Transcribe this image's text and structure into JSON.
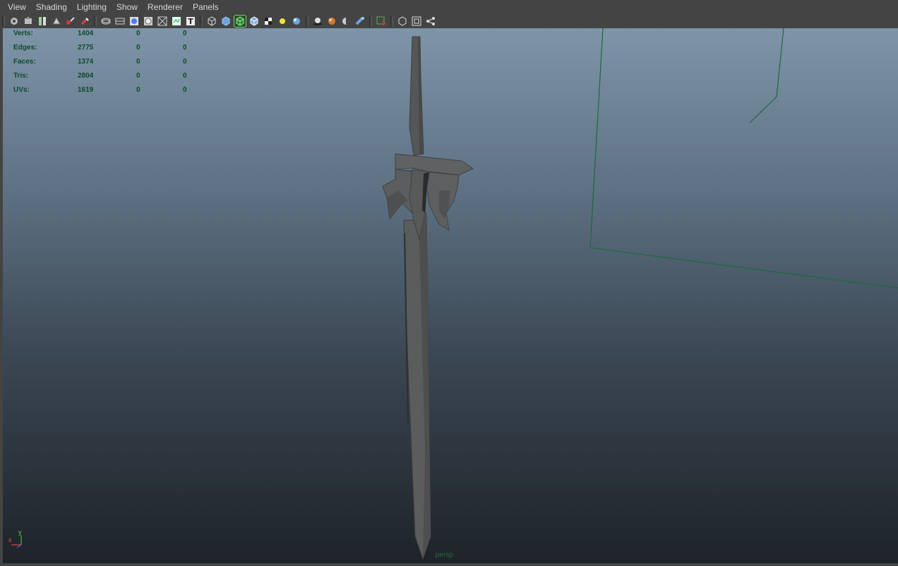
{
  "menu": [
    "View",
    "Shading",
    "Lighting",
    "Show",
    "Renderer",
    "Panels"
  ],
  "toolbar": {
    "groups": [
      [
        "camera-attributes-icon",
        "camera-bookmark-icon",
        "image-plane-icon",
        "2d-pan-zoom-icon",
        "grease-pencil-icon",
        "film-gate-icon"
      ],
      [
        "grid-icon",
        "resolution-gate-icon",
        "field-chart-icon",
        "safe-action-icon",
        "safe-title-icon",
        "heads-up-display-icon",
        "text-icon"
      ],
      [
        "wireframe-icon",
        "smooth-shade-icon",
        "wireframe-on-shaded-icon",
        "bounding-box-icon",
        "textured-icon",
        "default-light-icon",
        "use-all-lights-icon"
      ],
      [
        "shadows-icon",
        "ambient-occlusion-icon",
        "screen-space-ao-icon",
        "motion-blur-icon"
      ],
      [
        "xray-selection-icon"
      ],
      [
        "isolate-select-icon",
        "xray-icon",
        "node-editor-icon"
      ]
    ],
    "text_glyph": "T"
  },
  "hud": {
    "rows": [
      {
        "label": "Verts:",
        "v1": "1404",
        "v2": "0",
        "v3": "0"
      },
      {
        "label": "Edges:",
        "v1": "2775",
        "v2": "0",
        "v3": "0"
      },
      {
        "label": "Faces:",
        "v1": "1374",
        "v2": "0",
        "v3": "0"
      },
      {
        "label": "Tris:",
        "v1": "2804",
        "v2": "0",
        "v3": "0"
      },
      {
        "label": "UVs:",
        "v1": "1619",
        "v2": "0",
        "v3": "0"
      }
    ]
  },
  "viewport": {
    "camera": "persp",
    "axis": {
      "x": "x",
      "y": "y"
    },
    "colors": {
      "background_top": "#7e94a8",
      "background_bottom": "#1e2329",
      "hud_text": "#0f4a2a",
      "camera_frame": "#1a6a3a",
      "sword": "#5a5a5a",
      "axis_x": "#ff4a4a",
      "axis_y": "#4cd24c"
    }
  }
}
